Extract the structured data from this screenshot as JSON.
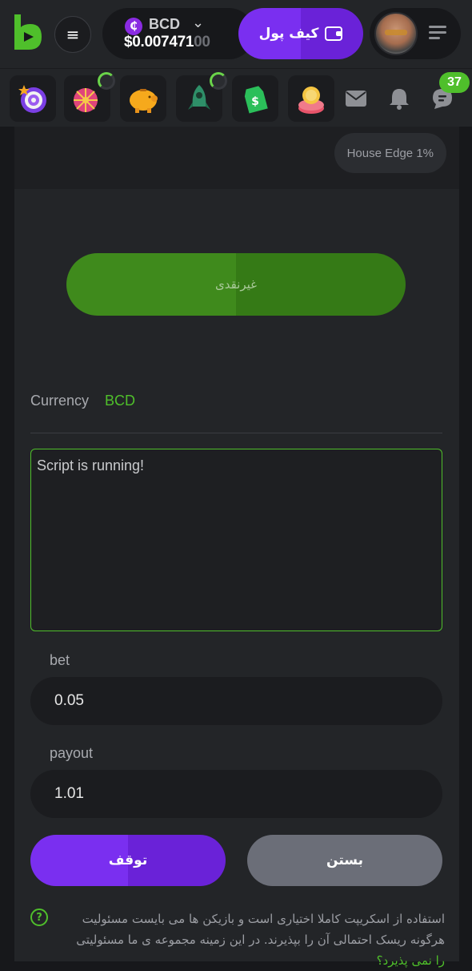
{
  "header": {
    "currency": "BCD",
    "balance_main": "$0.007471",
    "balance_dim": "00",
    "wallet_label": "کیف پول",
    "notification_count": "37"
  },
  "icons": [
    "target-icon",
    "wheel-icon",
    "piggy-bank-icon",
    "rocket-icon",
    "price-tag-icon",
    "coin-stack-icon",
    "mail-icon",
    "bell-icon",
    "chat-icon"
  ],
  "panel": {
    "house_edge": "House Edge 1%",
    "green_button_label": "غیرنقدی",
    "currency_label": "Currency",
    "currency_value": "BCD",
    "script_output": "Script is running!",
    "bet_label": "bet",
    "bet_value": "0.05",
    "payout_label": "payout",
    "payout_value": "1.01",
    "stop_label": "توقف",
    "close_label": "بستن",
    "disclaimer_line1": "استفاده از اسکریپت کاملا اختیاری است و بازیکن ها می بایست مسئولیت",
    "disclaimer_line2": "هرگونه ریسک احتمالی آن را بپذیرند. در این زمینه مجموعه ی ما مسئولیتی",
    "disclaimer_line3": "را نمی پذیرد؟"
  },
  "colors": {
    "accent_purple": "#7a2ff0",
    "accent_green": "#4fbf2b",
    "background": "#17181b",
    "surface": "#232528"
  }
}
